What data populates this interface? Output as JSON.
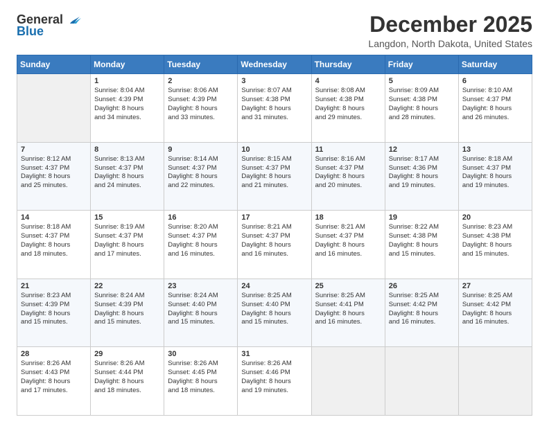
{
  "header": {
    "logo_line1": "General",
    "logo_line2": "Blue",
    "month_title": "December 2025",
    "location": "Langdon, North Dakota, United States"
  },
  "weekdays": [
    "Sunday",
    "Monday",
    "Tuesday",
    "Wednesday",
    "Thursday",
    "Friday",
    "Saturday"
  ],
  "weeks": [
    [
      {
        "day": "",
        "info": ""
      },
      {
        "day": "1",
        "info": "Sunrise: 8:04 AM\nSunset: 4:39 PM\nDaylight: 8 hours\nand 34 minutes."
      },
      {
        "day": "2",
        "info": "Sunrise: 8:06 AM\nSunset: 4:39 PM\nDaylight: 8 hours\nand 33 minutes."
      },
      {
        "day": "3",
        "info": "Sunrise: 8:07 AM\nSunset: 4:38 PM\nDaylight: 8 hours\nand 31 minutes."
      },
      {
        "day": "4",
        "info": "Sunrise: 8:08 AM\nSunset: 4:38 PM\nDaylight: 8 hours\nand 29 minutes."
      },
      {
        "day": "5",
        "info": "Sunrise: 8:09 AM\nSunset: 4:38 PM\nDaylight: 8 hours\nand 28 minutes."
      },
      {
        "day": "6",
        "info": "Sunrise: 8:10 AM\nSunset: 4:37 PM\nDaylight: 8 hours\nand 26 minutes."
      }
    ],
    [
      {
        "day": "7",
        "info": "Sunrise: 8:12 AM\nSunset: 4:37 PM\nDaylight: 8 hours\nand 25 minutes."
      },
      {
        "day": "8",
        "info": "Sunrise: 8:13 AM\nSunset: 4:37 PM\nDaylight: 8 hours\nand 24 minutes."
      },
      {
        "day": "9",
        "info": "Sunrise: 8:14 AM\nSunset: 4:37 PM\nDaylight: 8 hours\nand 22 minutes."
      },
      {
        "day": "10",
        "info": "Sunrise: 8:15 AM\nSunset: 4:37 PM\nDaylight: 8 hours\nand 21 minutes."
      },
      {
        "day": "11",
        "info": "Sunrise: 8:16 AM\nSunset: 4:37 PM\nDaylight: 8 hours\nand 20 minutes."
      },
      {
        "day": "12",
        "info": "Sunrise: 8:17 AM\nSunset: 4:36 PM\nDaylight: 8 hours\nand 19 minutes."
      },
      {
        "day": "13",
        "info": "Sunrise: 8:18 AM\nSunset: 4:37 PM\nDaylight: 8 hours\nand 19 minutes."
      }
    ],
    [
      {
        "day": "14",
        "info": "Sunrise: 8:18 AM\nSunset: 4:37 PM\nDaylight: 8 hours\nand 18 minutes."
      },
      {
        "day": "15",
        "info": "Sunrise: 8:19 AM\nSunset: 4:37 PM\nDaylight: 8 hours\nand 17 minutes."
      },
      {
        "day": "16",
        "info": "Sunrise: 8:20 AM\nSunset: 4:37 PM\nDaylight: 8 hours\nand 16 minutes."
      },
      {
        "day": "17",
        "info": "Sunrise: 8:21 AM\nSunset: 4:37 PM\nDaylight: 8 hours\nand 16 minutes."
      },
      {
        "day": "18",
        "info": "Sunrise: 8:21 AM\nSunset: 4:37 PM\nDaylight: 8 hours\nand 16 minutes."
      },
      {
        "day": "19",
        "info": "Sunrise: 8:22 AM\nSunset: 4:38 PM\nDaylight: 8 hours\nand 15 minutes."
      },
      {
        "day": "20",
        "info": "Sunrise: 8:23 AM\nSunset: 4:38 PM\nDaylight: 8 hours\nand 15 minutes."
      }
    ],
    [
      {
        "day": "21",
        "info": "Sunrise: 8:23 AM\nSunset: 4:39 PM\nDaylight: 8 hours\nand 15 minutes."
      },
      {
        "day": "22",
        "info": "Sunrise: 8:24 AM\nSunset: 4:39 PM\nDaylight: 8 hours\nand 15 minutes."
      },
      {
        "day": "23",
        "info": "Sunrise: 8:24 AM\nSunset: 4:40 PM\nDaylight: 8 hours\nand 15 minutes."
      },
      {
        "day": "24",
        "info": "Sunrise: 8:25 AM\nSunset: 4:40 PM\nDaylight: 8 hours\nand 15 minutes."
      },
      {
        "day": "25",
        "info": "Sunrise: 8:25 AM\nSunset: 4:41 PM\nDaylight: 8 hours\nand 16 minutes."
      },
      {
        "day": "26",
        "info": "Sunrise: 8:25 AM\nSunset: 4:42 PM\nDaylight: 8 hours\nand 16 minutes."
      },
      {
        "day": "27",
        "info": "Sunrise: 8:25 AM\nSunset: 4:42 PM\nDaylight: 8 hours\nand 16 minutes."
      }
    ],
    [
      {
        "day": "28",
        "info": "Sunrise: 8:26 AM\nSunset: 4:43 PM\nDaylight: 8 hours\nand 17 minutes."
      },
      {
        "day": "29",
        "info": "Sunrise: 8:26 AM\nSunset: 4:44 PM\nDaylight: 8 hours\nand 18 minutes."
      },
      {
        "day": "30",
        "info": "Sunrise: 8:26 AM\nSunset: 4:45 PM\nDaylight: 8 hours\nand 18 minutes."
      },
      {
        "day": "31",
        "info": "Sunrise: 8:26 AM\nSunset: 4:46 PM\nDaylight: 8 hours\nand 19 minutes."
      },
      {
        "day": "",
        "info": ""
      },
      {
        "day": "",
        "info": ""
      },
      {
        "day": "",
        "info": ""
      }
    ]
  ]
}
